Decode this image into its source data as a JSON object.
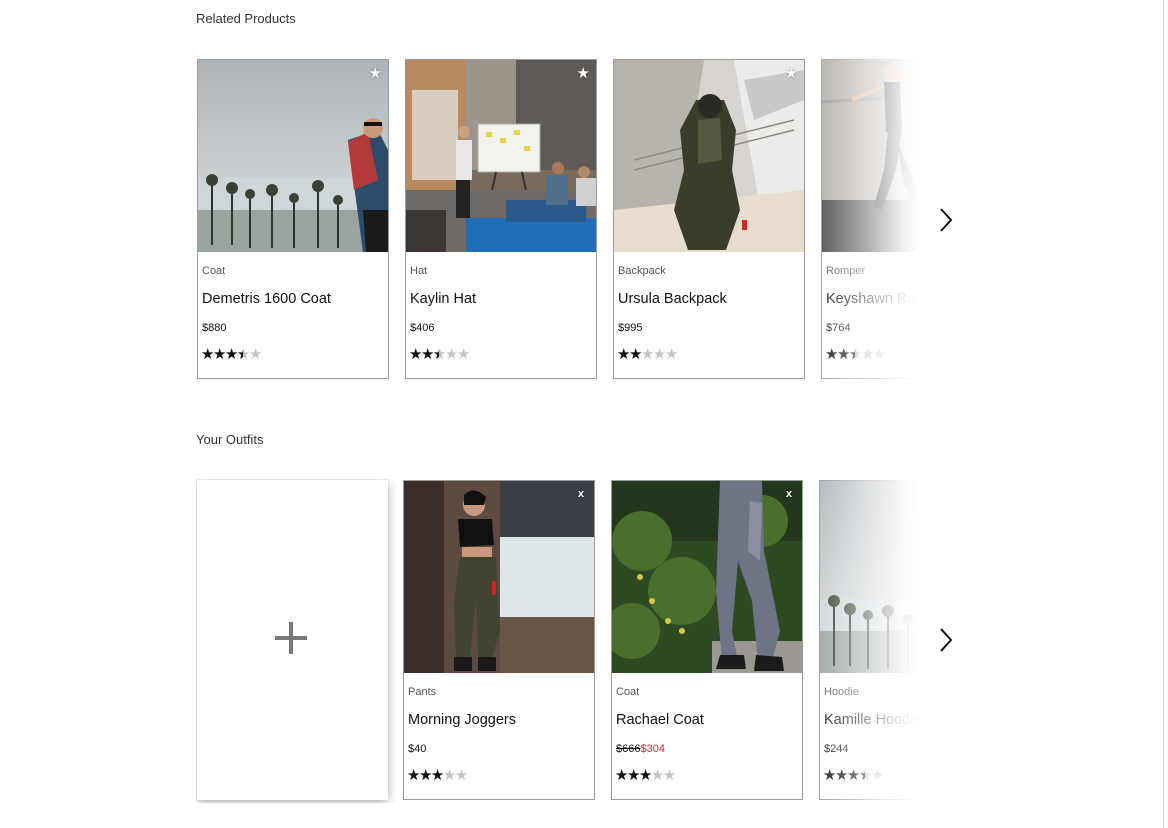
{
  "related": {
    "title": "Related Products",
    "products": [
      {
        "category": "Coat",
        "name": "Demetris 1600 Coat",
        "price": "$880",
        "rating": 3.5
      },
      {
        "category": "Hat",
        "name": "Kaylin Hat",
        "price": "$406",
        "rating": 2.5
      },
      {
        "category": "Backpack",
        "name": "Ursula Backpack",
        "price": "$995",
        "rating": 2
      },
      {
        "category": "Romper",
        "name": "Keyshawn Romper",
        "price": "$764",
        "rating": 2.5
      }
    ],
    "favorite_icon": "star-icon",
    "next_icon": "chevron-right-icon"
  },
  "outfit": {
    "title": "Your Outfits",
    "add_icon": "plus-icon",
    "products": [
      {
        "category": "Pants",
        "name": "Morning Joggers",
        "price": "$40",
        "rating": 3
      },
      {
        "category": "Coat",
        "name": "Rachael Coat",
        "original_price": "$666",
        "sale_price": "$304",
        "rating": 3
      },
      {
        "category": "Hoodie",
        "name": "Kamille Hoodie",
        "price": "$244",
        "rating": 3.5
      }
    ],
    "remove_icon": "close-icon",
    "next_icon": "chevron-right-icon"
  },
  "colors": {
    "sale": "#e02030",
    "star_filled": "#111111",
    "star_empty": "#c4c4c4",
    "border": "#9a9a9a"
  }
}
